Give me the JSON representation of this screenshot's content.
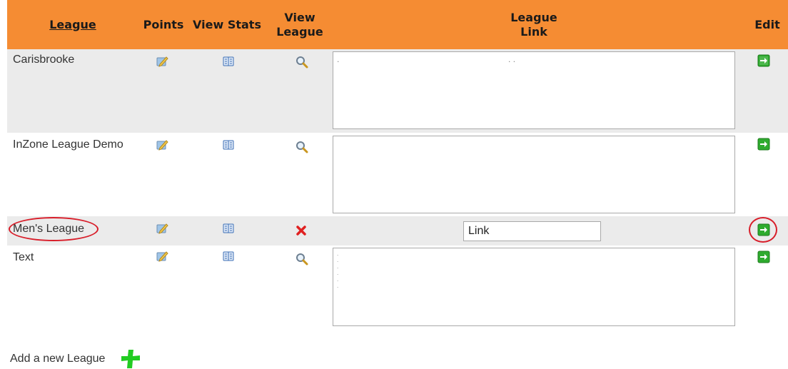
{
  "table": {
    "headers": {
      "league": "League",
      "points": "Points",
      "view_stats": "View Stats",
      "view_league_1": "View",
      "view_league_2": "League",
      "league_link_1": "League",
      "league_link_2": "Link",
      "edit": "Edit"
    },
    "rows": [
      {
        "name": "Carisbrooke",
        "link_text": ".                                                                       . .",
        "view_icon": "magnifier-icon"
      },
      {
        "name": "InZone League Demo",
        "link_text": "",
        "view_icon": "magnifier-icon"
      },
      {
        "name": "Men's League",
        "link_value": "Link",
        "view_icon": "red-x-icon"
      },
      {
        "name": "Text",
        "link_text": ".\n.\n.\n.\n.\n.",
        "view_icon": "magnifier-icon"
      }
    ]
  },
  "footer": {
    "add_label": "Add a new League"
  },
  "colors": {
    "header_bg": "#f58c33",
    "row_alt_bg": "#ebebeb",
    "edit_green": "#2eab2e",
    "annotation_red": "#d81e2a",
    "add_plus_green": "#22cc22"
  }
}
